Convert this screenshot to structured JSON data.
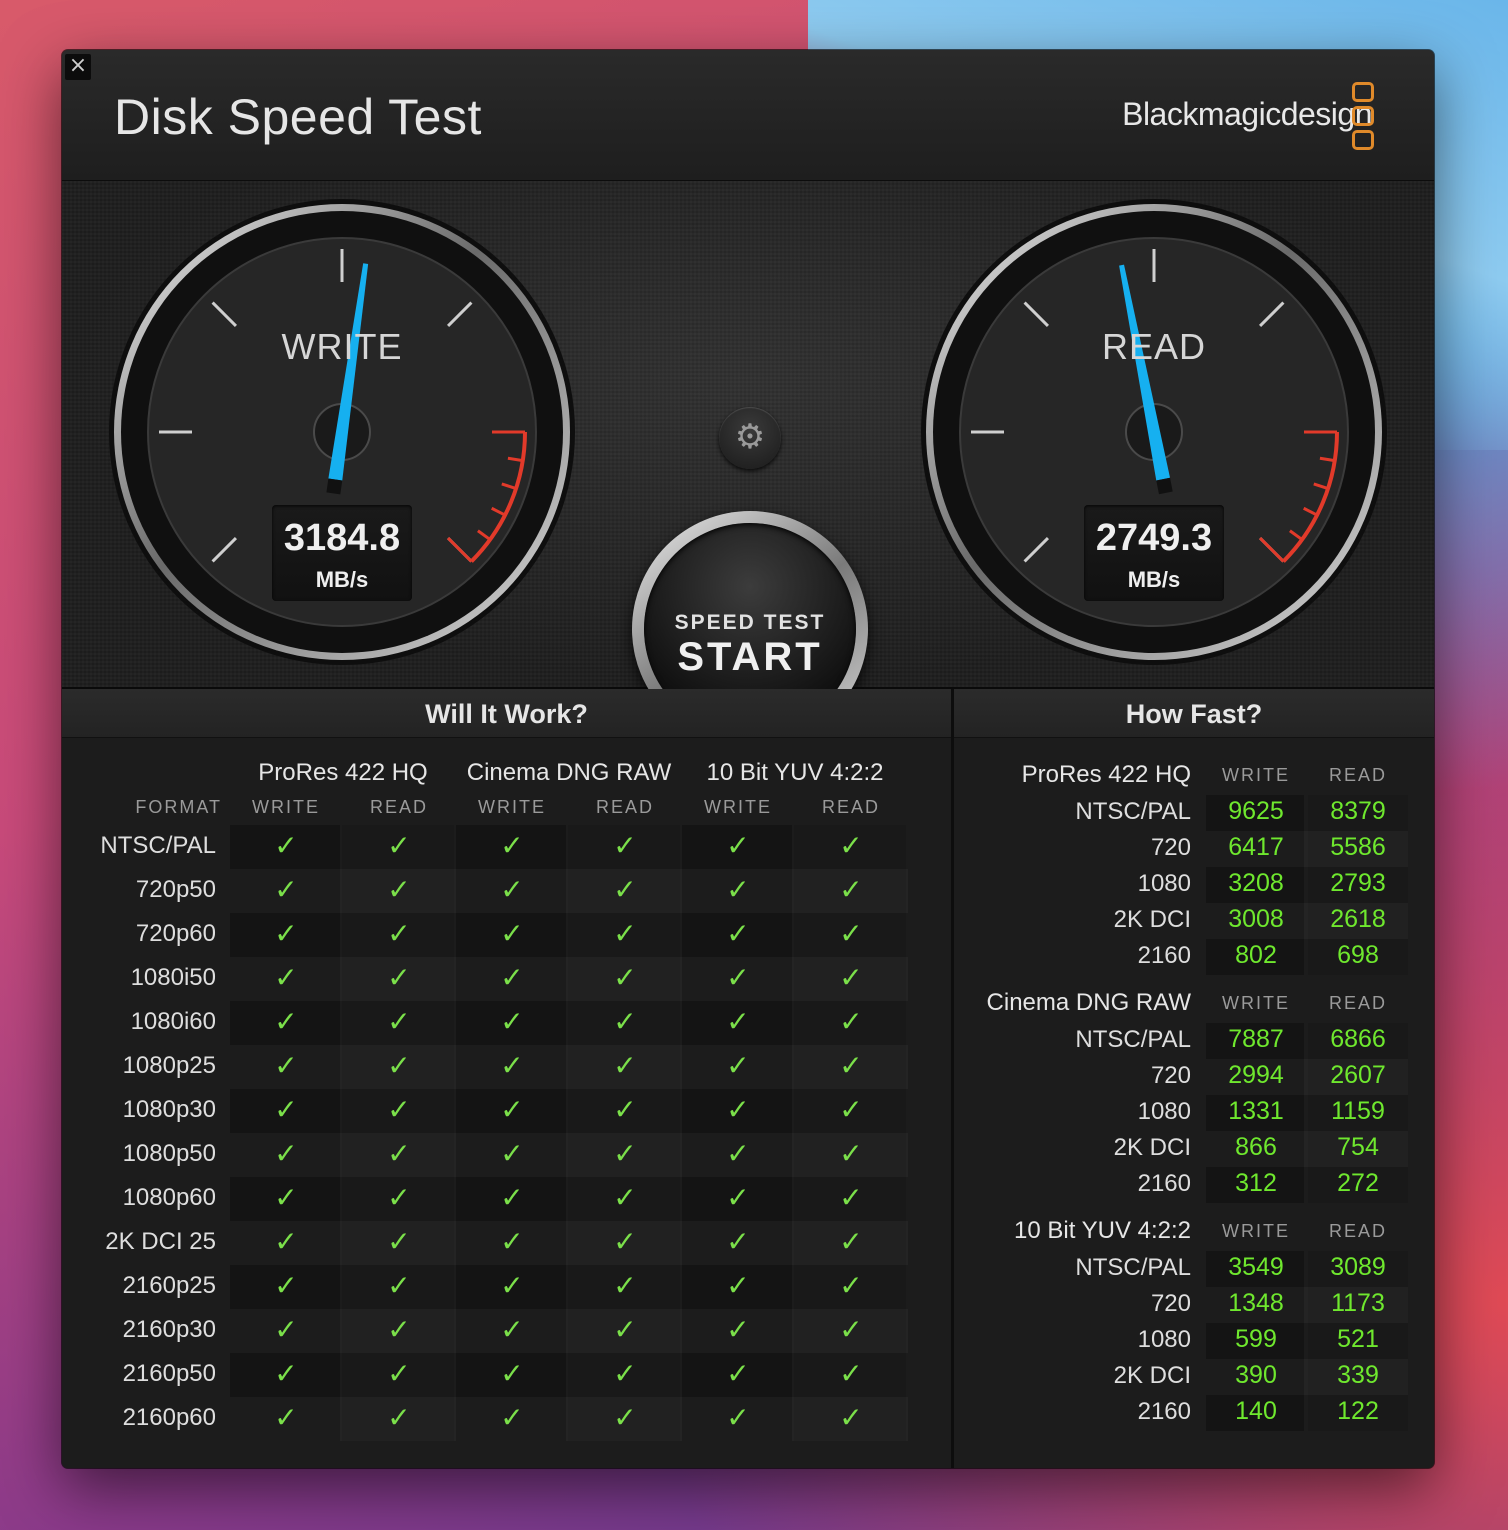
{
  "window": {
    "close_label": "×",
    "title": "Disk Speed Test",
    "brand": "Blackmagicdesign"
  },
  "colors": {
    "needle": "#16b0f0",
    "check": "#7be04a",
    "speed_number": "#6fe82e",
    "brand_mark": "#e08a2a",
    "redline": "#e23a2a"
  },
  "gauges": {
    "write": {
      "label": "WRITE",
      "value": "3184.8",
      "unit": "MB/s"
    },
    "read": {
      "label": "READ",
      "value": "2749.3",
      "unit": "MB/s"
    }
  },
  "controls": {
    "settings_icon": "gear-icon",
    "start_top": "SPEED TEST",
    "start_main": "START"
  },
  "will_it_work": {
    "title": "Will It Work?",
    "format_header": "FORMAT",
    "write_header": "WRITE",
    "read_header": "READ",
    "groups": [
      "ProRes 422 HQ",
      "Cinema DNG RAW",
      "10 Bit YUV 4:2:2"
    ],
    "check_glyph": "✓",
    "rows": [
      "NTSC/PAL",
      "720p50",
      "720p60",
      "1080i50",
      "1080i60",
      "1080p25",
      "1080p30",
      "1080p50",
      "1080p60",
      "2K DCI 25",
      "2160p25",
      "2160p30",
      "2160p50",
      "2160p60"
    ]
  },
  "how_fast": {
    "title": "How Fast?",
    "write_header": "WRITE",
    "read_header": "READ",
    "groups": [
      {
        "name": "ProRes 422 HQ",
        "rows": [
          {
            "label": "NTSC/PAL",
            "write": "9625",
            "read": "8379"
          },
          {
            "label": "720",
            "write": "6417",
            "read": "5586"
          },
          {
            "label": "1080",
            "write": "3208",
            "read": "2793"
          },
          {
            "label": "2K DCI",
            "write": "3008",
            "read": "2618"
          },
          {
            "label": "2160",
            "write": "802",
            "read": "698"
          }
        ]
      },
      {
        "name": "Cinema DNG RAW",
        "rows": [
          {
            "label": "NTSC/PAL",
            "write": "7887",
            "read": "6866"
          },
          {
            "label": "720",
            "write": "2994",
            "read": "2607"
          },
          {
            "label": "1080",
            "write": "1331",
            "read": "1159"
          },
          {
            "label": "2K DCI",
            "write": "866",
            "read": "754"
          },
          {
            "label": "2160",
            "write": "312",
            "read": "272"
          }
        ]
      },
      {
        "name": "10 Bit YUV 4:2:2",
        "rows": [
          {
            "label": "NTSC/PAL",
            "write": "3549",
            "read": "3089"
          },
          {
            "label": "720",
            "write": "1348",
            "read": "1173"
          },
          {
            "label": "1080",
            "write": "599",
            "read": "521"
          },
          {
            "label": "2K DCI",
            "write": "390",
            "read": "339"
          },
          {
            "label": "2160",
            "write": "140",
            "read": "122"
          }
        ]
      }
    ]
  }
}
